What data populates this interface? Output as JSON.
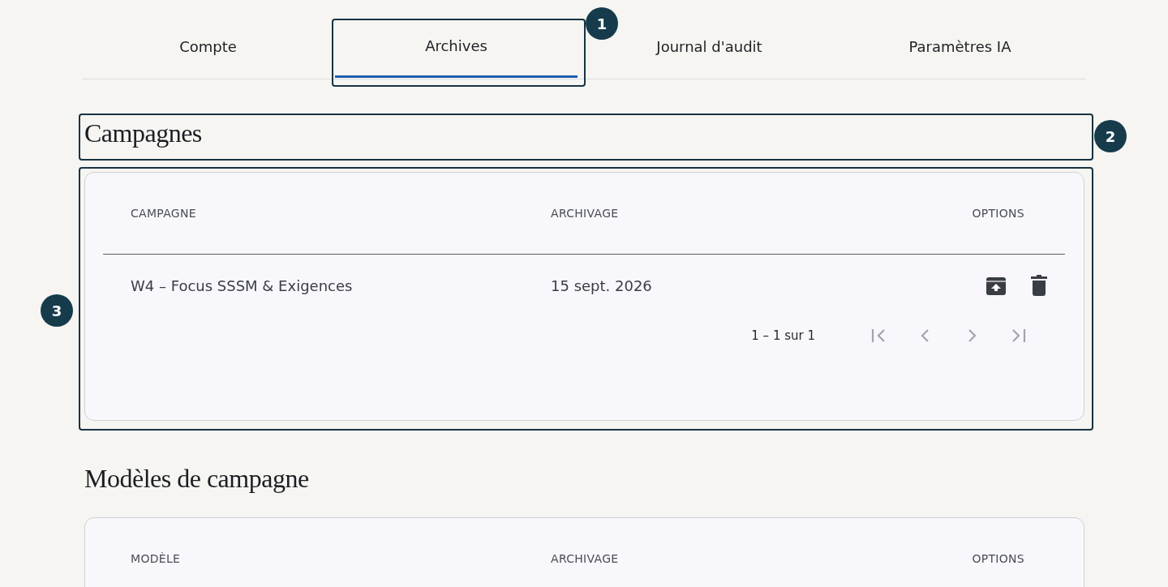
{
  "tabs": [
    {
      "label": "Compte",
      "selected": false
    },
    {
      "label": "Archives",
      "selected": true,
      "callout": "1"
    },
    {
      "label": "Journal d'audit",
      "selected": false
    },
    {
      "label": "Paramètres IA",
      "selected": false
    }
  ],
  "sections": [
    {
      "title": "Campagnes",
      "title_callout": "2",
      "table_callout": "3",
      "columns": [
        "CAMPAGNE",
        "ARCHIVAGE",
        "OPTIONS"
      ],
      "rows": [
        {
          "name": "W4 – Focus SSSM & Exigences",
          "date": "15 sept. 2026",
          "actions": [
            {
              "kind": "unarchive"
            },
            {
              "kind": "delete"
            }
          ]
        }
      ],
      "pagination": {
        "range": "1 – 1 sur 1",
        "buttons": [
          {
            "kind": "first",
            "disabled": true
          },
          {
            "kind": "prev",
            "disabled": true
          },
          {
            "kind": "next",
            "disabled": true
          },
          {
            "kind": "last",
            "disabled": true
          }
        ]
      }
    },
    {
      "title": "Modèles de campagne",
      "columns": [
        "MODÈLE",
        "ARCHIVAGE",
        "OPTIONS"
      ]
    }
  ]
}
